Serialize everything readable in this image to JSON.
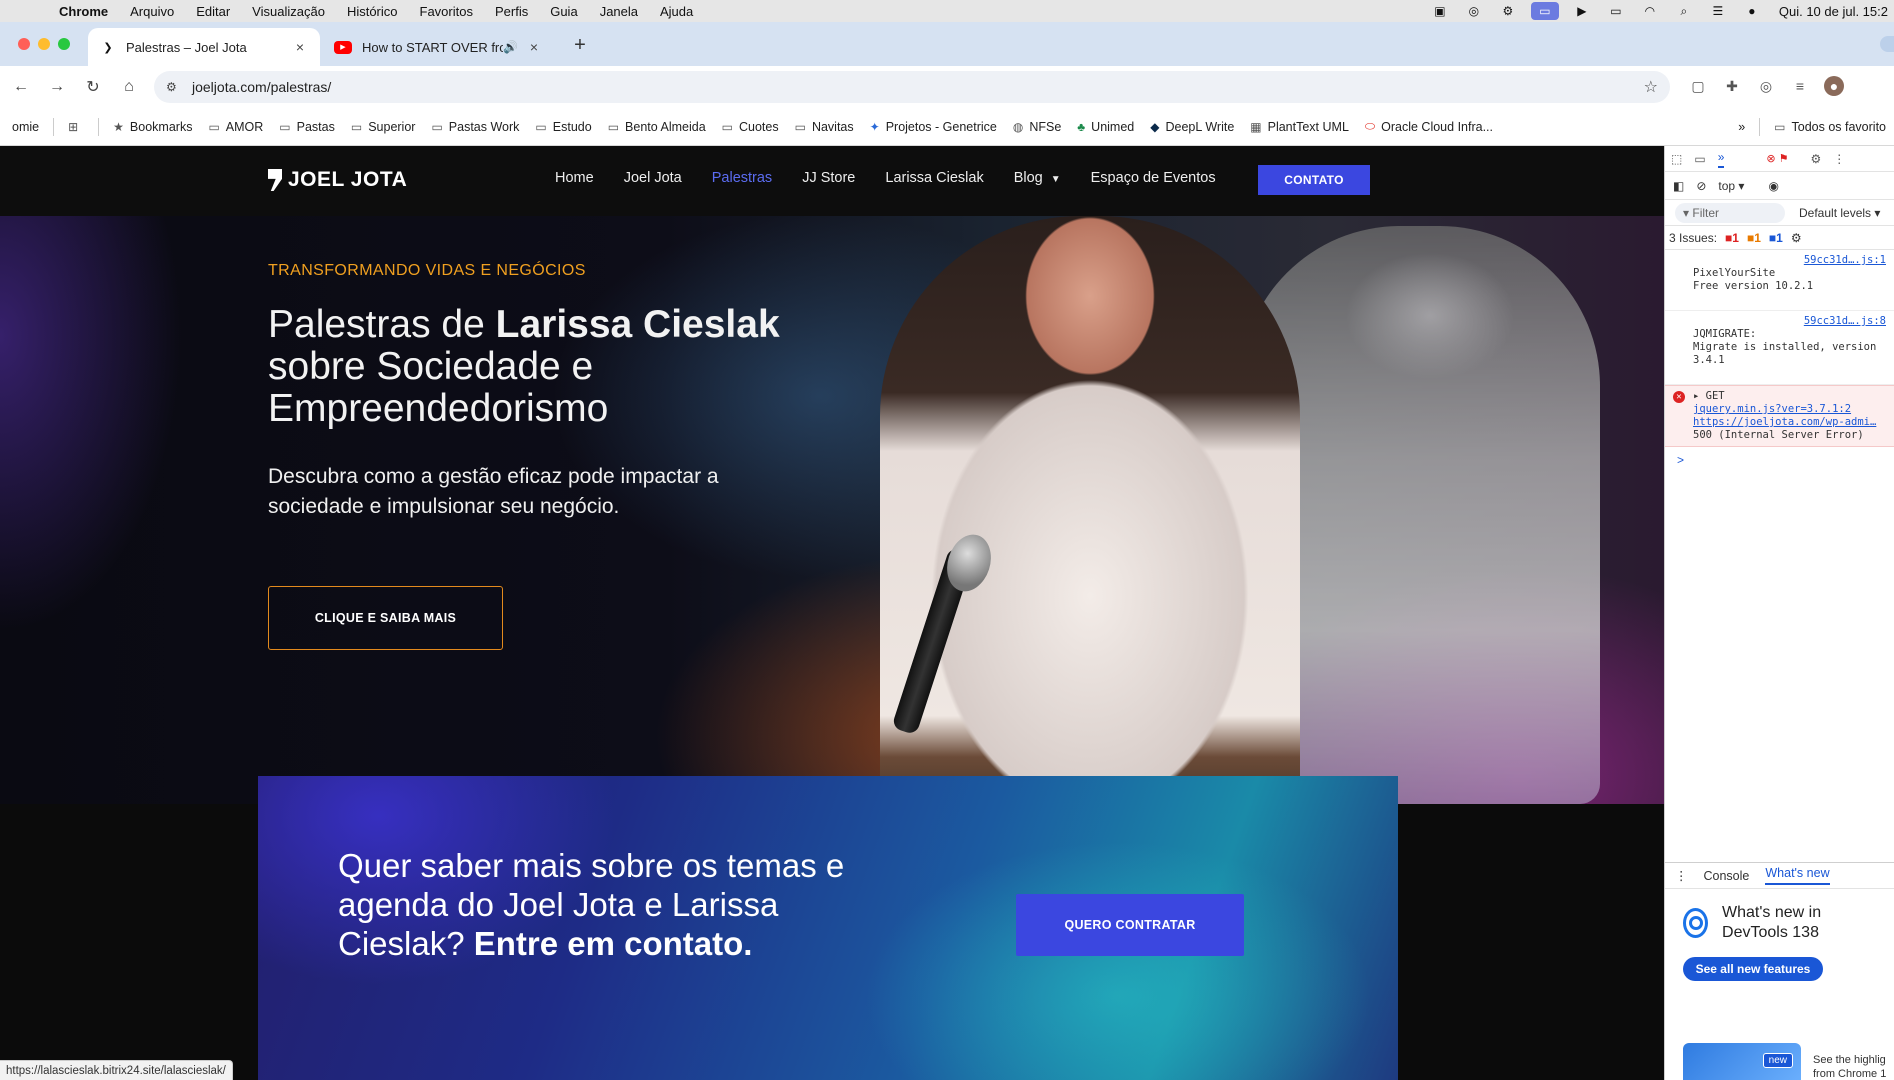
{
  "menubar": {
    "apple": "",
    "items": [
      "Chrome",
      "Arquivo",
      "Editar",
      "Visualização",
      "Histórico",
      "Favoritos",
      "Perfis",
      "Guia",
      "Janela",
      "Ajuda"
    ],
    "clock": "Qui. 10 de jul.  15:2"
  },
  "tabs": {
    "active_title": "Palestras – Joel Jota",
    "inactive_title": "How to START OVER from",
    "close": "×",
    "sound": "🔊",
    "new_tab": "+"
  },
  "toolbar": {
    "url": "joeljota.com/palestras/",
    "back": "←",
    "forward": "→",
    "reload": "↻",
    "home": "⌂",
    "star": "☆"
  },
  "bookmarks": {
    "items": [
      {
        "label": "omie",
        "icon": "text"
      },
      {
        "label": "",
        "icon": "apps-grid-icon"
      },
      {
        "label": "Bookmarks",
        "icon": "star-icon"
      },
      {
        "label": "AMOR",
        "icon": "folder-icon"
      },
      {
        "label": "Pastas",
        "icon": "folder-icon"
      },
      {
        "label": "Superior",
        "icon": "folder-icon"
      },
      {
        "label": "Pastas Work",
        "icon": "folder-icon"
      },
      {
        "label": "Estudo",
        "icon": "folder-icon"
      },
      {
        "label": "Bento Almeida",
        "icon": "folder-icon"
      },
      {
        "label": "Cuotes",
        "icon": "folder-icon"
      },
      {
        "label": "Navitas",
        "icon": "folder-icon"
      },
      {
        "label": "Projetos - Genetrice",
        "icon": "site-icon"
      },
      {
        "label": "NFSe",
        "icon": "site-icon"
      },
      {
        "label": "Unimed",
        "icon": "site-icon"
      },
      {
        "label": "DeepL Write",
        "icon": "site-icon"
      },
      {
        "label": "PlantText UML",
        "icon": "site-icon"
      },
      {
        "label": "Oracle Cloud Infra...",
        "icon": "site-icon"
      }
    ],
    "overflow": "»",
    "all_label": "Todos os favorito"
  },
  "site": {
    "logo": "JOEL JOTA",
    "nav": [
      "Home",
      "Joel Jota",
      "Palestras",
      "JJ Store",
      "Larissa Cieslak",
      "Blog",
      "Espaço de Eventos"
    ],
    "nav_active": "Palestras",
    "cta": "CONTATO",
    "hero": {
      "kicker": "TRANSFORMANDO VIDAS E NEGÓCIOS",
      "title_1": "Palestras de ",
      "title_bold": "Larissa Cieslak",
      "title_2": " sobre Sociedade e Empreendedorismo",
      "subtitle": "Descubra como a gestão eficaz pode impactar a sociedade e impulsionar seu negócio.",
      "button": "CLIQUE E SAIBA MAIS"
    },
    "band": {
      "text_1": "Quer saber mais sobre os temas e agenda do Joel Jota e Larissa Cieslak? ",
      "text_bold": "Entre em contato.",
      "button": "QUERO CONTRATAR"
    },
    "status_url": "https://lalascieslak.bitrix24.site/lalascieslak/"
  },
  "devtools": {
    "context": "top ▾",
    "filter_placeholder": "Filter",
    "levels": "Default levels ▾",
    "issues_label": "3 Issues:",
    "issue_counts": [
      "1",
      "1",
      "1"
    ],
    "logs": [
      {
        "text": "PixelYourSite\nFree version 10.2.1",
        "src": "59cc31d….js:1",
        "type": "info"
      },
      {
        "text": "JQMIGRATE:\nMigrate is installed, version 3.4.1",
        "src": "59cc31d….js:8",
        "type": "info"
      }
    ],
    "error": {
      "method": "▸ GET",
      "link1": "jquery.min.js?ver=3.7.1:2",
      "link2": "https://joeljota.com/wp-admi…",
      "status": "500 (Internal Server Error)"
    },
    "prompt": ">",
    "drawer_tabs": [
      "Console",
      "What's new"
    ],
    "whats_new_title": "What's new in DevTools 138",
    "whats_new_button": "See all new features",
    "new_badge": "new",
    "card_text": "See the highlig from Chrome 1"
  },
  "colors": {
    "accent": "#3b47e0",
    "orange": "#f0a020",
    "nav_active": "#5b6cf0"
  }
}
